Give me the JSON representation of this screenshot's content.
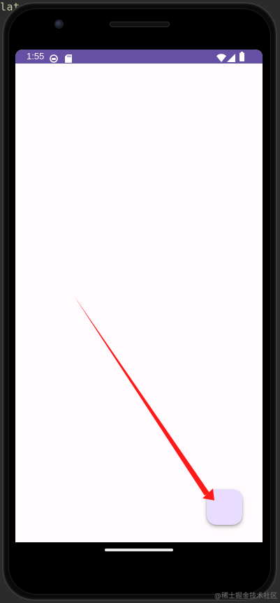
{
  "ide": {
    "text_fragment": "lat"
  },
  "status_bar": {
    "time": "1:55",
    "icons": [
      "robot-face-icon",
      "sd-card-icon",
      "wifi-icon",
      "cell-signal-icon",
      "battery-icon"
    ],
    "color": "#6650a4"
  },
  "screen": {
    "background": "#fffbfe"
  },
  "fab": {
    "color": "#e8ddff"
  },
  "annotation": {
    "arrow_color": "#ff1a1a"
  },
  "watermark": {
    "text": "@稀土掘金技术社区"
  }
}
